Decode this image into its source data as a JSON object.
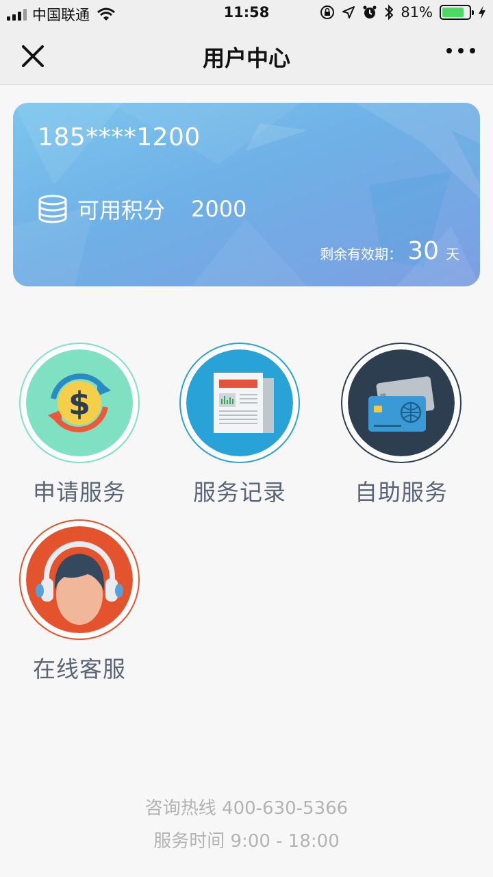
{
  "status_bar": {
    "carrier": "中国联通",
    "time": "11:58",
    "battery": "81%",
    "battery_level": 0.81,
    "icons": [
      "signal-icon",
      "wifi-icon",
      "orientation-lock-icon",
      "location-icon",
      "alarm-icon",
      "bluetooth-icon",
      "battery-icon",
      "charging-icon"
    ]
  },
  "nav": {
    "title": "用户中心",
    "close_icon": "close-icon",
    "more_icon": "more-icon"
  },
  "card": {
    "phone": "185****1200",
    "points_label": "可用积分",
    "points_value": "2000",
    "validity_label": "剩余有效期：",
    "validity_days": "30",
    "validity_unit": "天",
    "colors": {
      "start": "#7cc6ee",
      "end": "#7d9fe2"
    }
  },
  "services": [
    {
      "label": "申请服务",
      "icon": "dollar-exchange-icon",
      "ring": "#7fe0c2"
    },
    {
      "label": "服务记录",
      "icon": "newspaper-icon",
      "ring": "#29a2d8"
    },
    {
      "label": "自助服务",
      "icon": "bank-card-icon",
      "ring": "#2c3e50"
    },
    {
      "label": "在线客服",
      "icon": "headset-agent-icon",
      "ring": "#e3532d"
    }
  ],
  "footer": {
    "hotline": "咨询热线 400-630-5366",
    "hours": "服务时间 9:00 - 18:00"
  }
}
